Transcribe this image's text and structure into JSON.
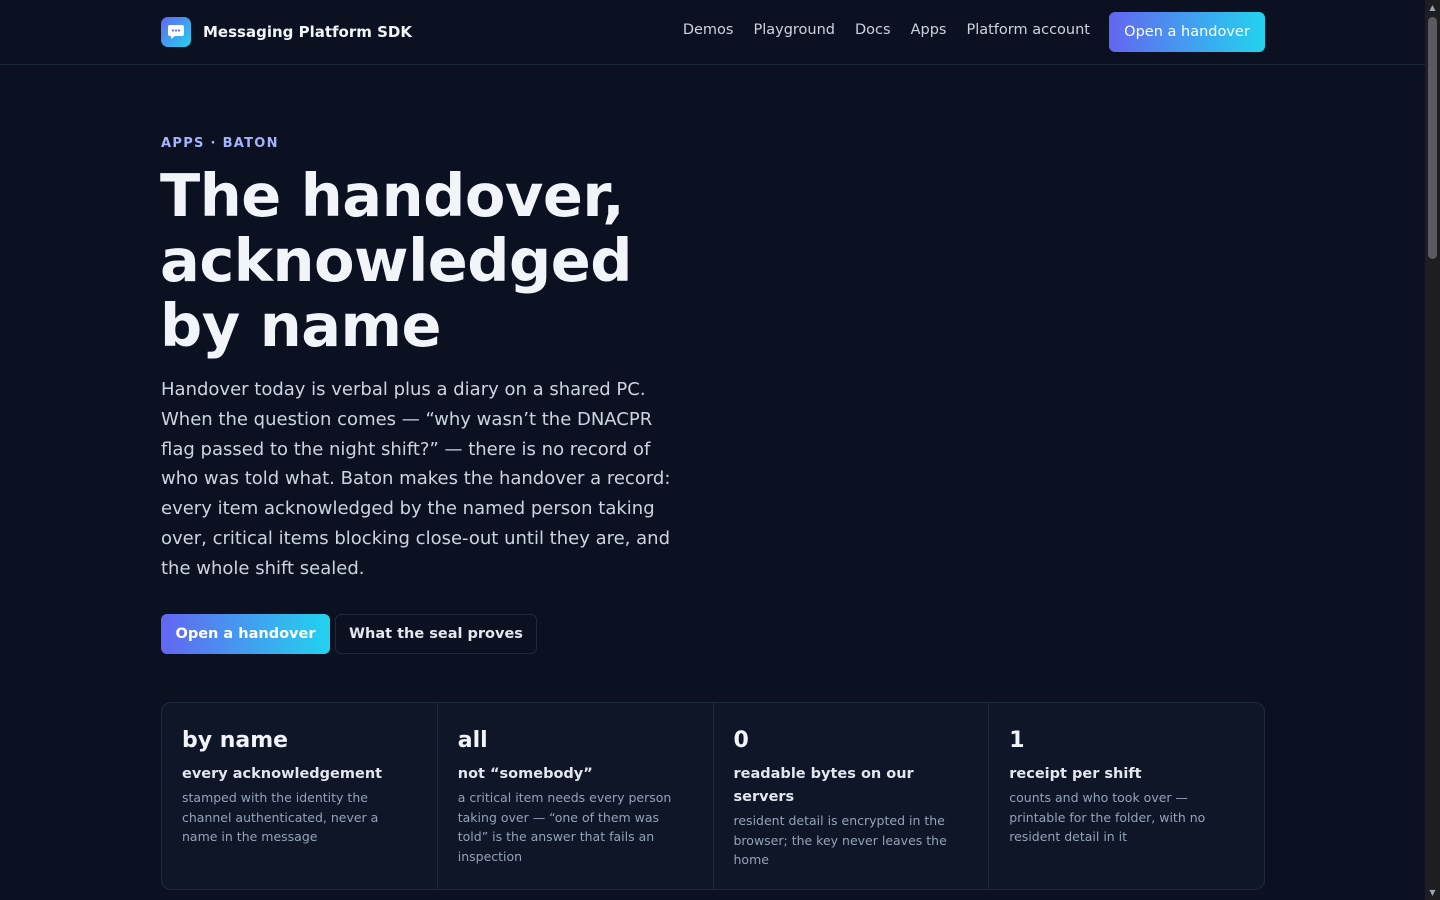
{
  "header": {
    "brand_name": "Messaging Platform SDK",
    "nav": [
      "Demos",
      "Playground",
      "Docs",
      "Apps",
      "Platform account"
    ],
    "cta_label": "Open a handover"
  },
  "hero": {
    "eyebrow": "APPS · BATON",
    "title": "The handover, acknowledged by name",
    "body": "Handover today is verbal plus a diary on a shared PC. When the question comes — “why wasn’t the DNACPR flag passed to the night shift?” — there is no record of who was told what. Baton makes the handover a record: every item acknowledged by the named person taking over, critical items blocking close-out until they are, and the whole shift sealed.",
    "primary_button": "Open a handover",
    "secondary_button": "What the seal proves"
  },
  "stats": [
    {
      "value": "by name",
      "label": "every acknowledgement",
      "desc": "stamped with the identity the channel authenticated, never a name in the message"
    },
    {
      "value": "all",
      "label": "not “somebody”",
      "desc": "a critical item needs every person taking over — “one of them was told” is the answer that fails an inspection"
    },
    {
      "value": "0",
      "label": "readable bytes on our servers",
      "desc": "resident detail is encrypted in the browser; the key never leaves the home"
    },
    {
      "value": "1",
      "label": "receipt per shift",
      "desc": "counts and who took over — printable for the folder, with no resident detail in it"
    }
  ],
  "colors": {
    "background": "#0b1120",
    "accent_start": "#6366f1",
    "accent_end": "#22d3ee",
    "eyebrow": "#a5b4fc"
  }
}
